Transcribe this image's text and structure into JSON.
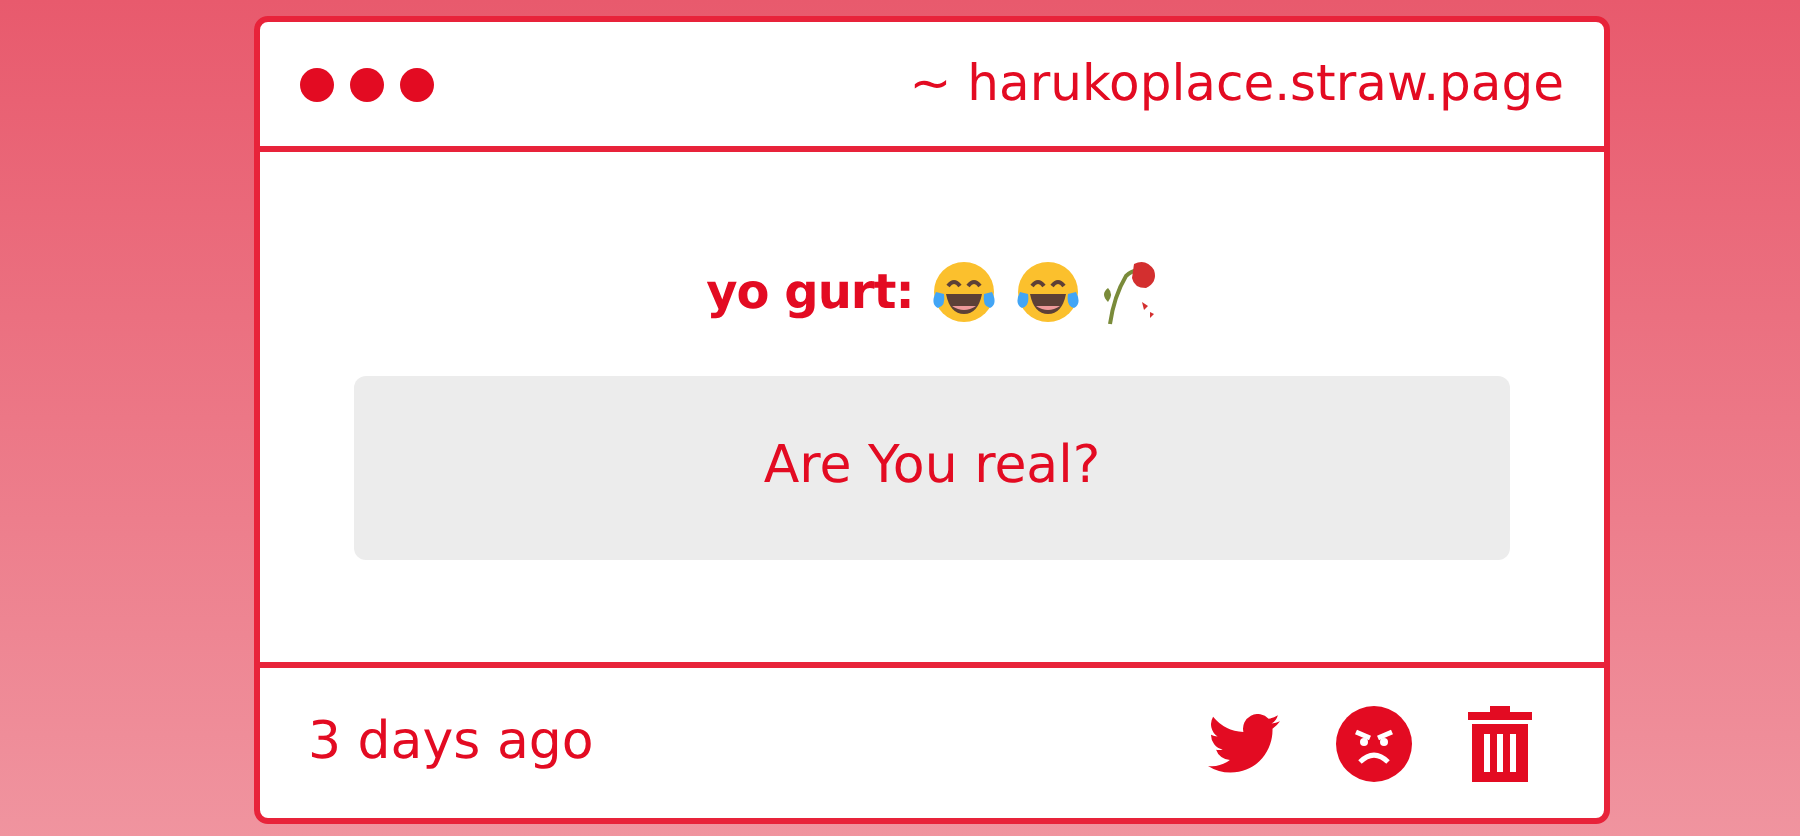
{
  "window": {
    "title": "~ harukoplace.straw.page",
    "dots": [
      {
        "kind": "dot"
      },
      {
        "kind": "dot"
      },
      {
        "kind": "dot"
      }
    ]
  },
  "message": {
    "author": "yo gurt:",
    "emoji": [
      {
        "kind": "laughing"
      },
      {
        "kind": "laughing"
      },
      {
        "kind": "wilted-flower"
      }
    ],
    "text": "Are You real?"
  },
  "footer": {
    "time": "3 days ago",
    "actions": [
      {
        "kind": "twitter"
      },
      {
        "kind": "angry"
      },
      {
        "kind": "trash"
      }
    ]
  }
}
